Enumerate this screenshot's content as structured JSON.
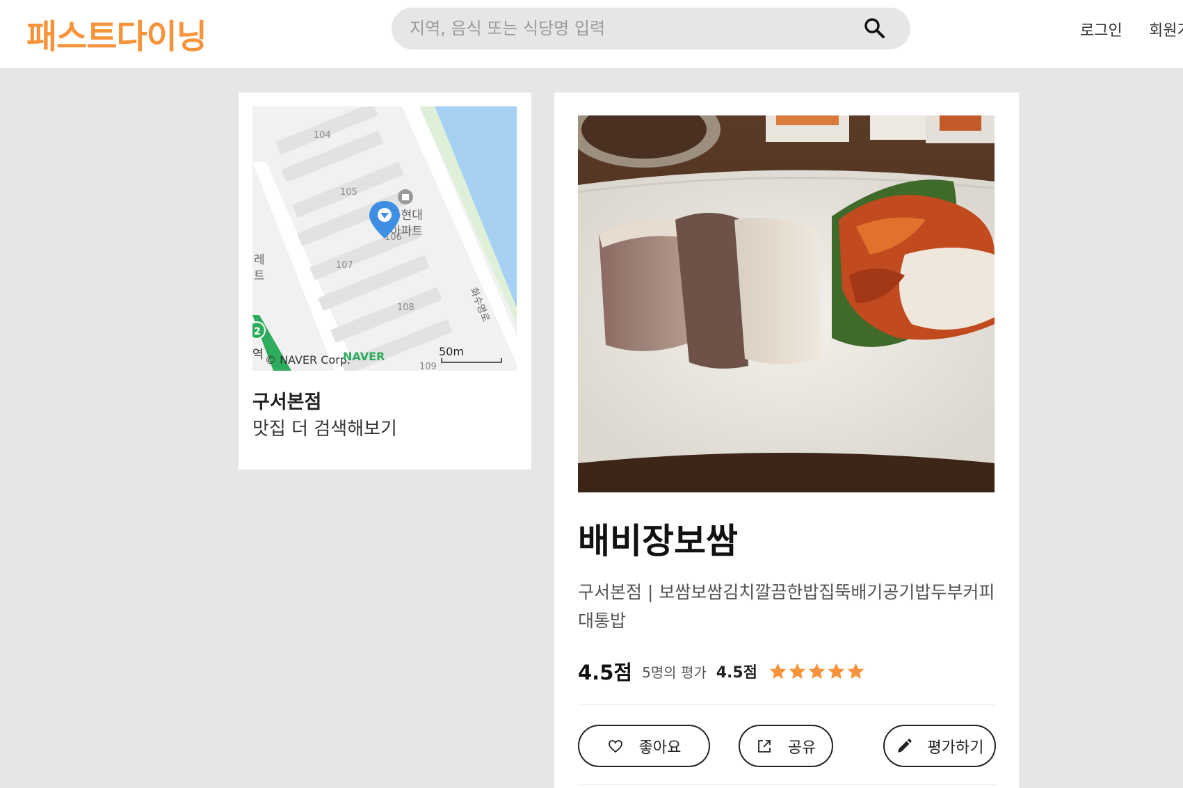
{
  "header": {
    "logo": "패스트다이닝",
    "search_placeholder": "지역, 음식 또는 식당명 입력",
    "login_label": "로그인",
    "signup_label": "회원가입"
  },
  "map": {
    "building_labels": [
      "104",
      "105",
      "106",
      "107",
      "108",
      "109"
    ],
    "place_label_line1": "동현대",
    "place_label_line2": "아파트",
    "side_label_line1": "레",
    "side_label_line2": "트",
    "road_label": "화수영로",
    "station_number": "2",
    "station_label": "역",
    "copyright": "© NAVER Corp.",
    "naver_logo": "NAVER",
    "scale_label": "50m"
  },
  "left_card": {
    "branch": "구서본점",
    "more_link": "맛집 더 검색해보기"
  },
  "restaurant": {
    "name": "배비장보쌈",
    "description": "구서본점 | 보쌈보쌈김치깔끔한밥집뚝배기공기밥두부커피대통밥",
    "score": "4.5점",
    "review_count": "5명의 평가",
    "score_small": "4.5점",
    "stars_filled": 5,
    "star_color": "#f7943b"
  },
  "actions": {
    "like": "좋아요",
    "share": "공유",
    "review": "평가하기"
  },
  "colors": {
    "brand": "#f7943b",
    "page_bg": "#e6e6e6"
  }
}
